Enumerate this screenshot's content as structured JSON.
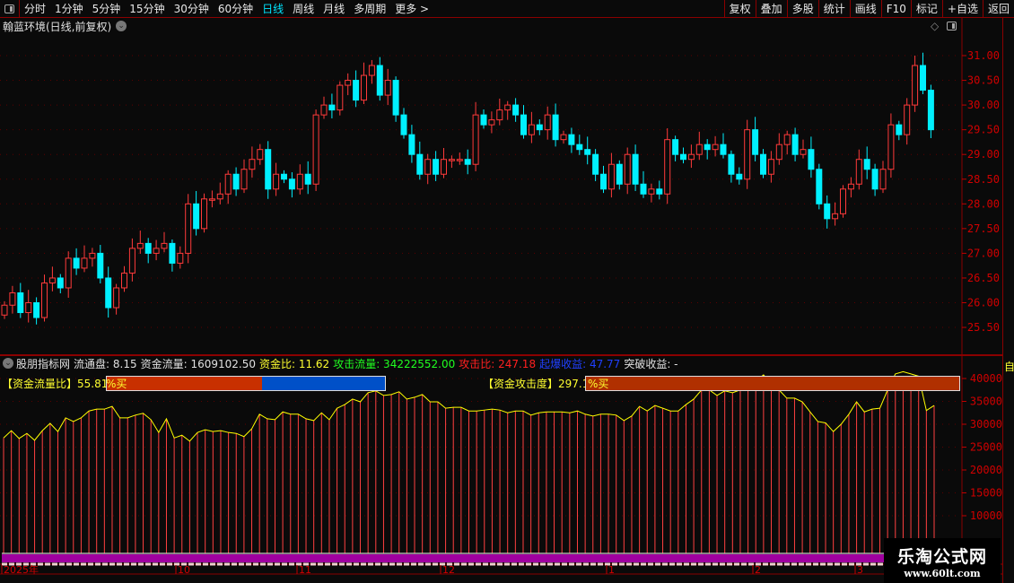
{
  "menu": {
    "periods": [
      "分时",
      "1分钟",
      "5分钟",
      "15分钟",
      "30分钟",
      "60分钟",
      "日线",
      "周线",
      "月线",
      "多周期",
      "更多 >"
    ],
    "active_period": "日线",
    "buttons": [
      "复权",
      "叠加",
      "多股",
      "统计",
      "画线",
      "F10",
      "标记",
      "+自选",
      "返回"
    ]
  },
  "title": "翰蓝环境(日线,前复权)",
  "colors": {
    "up": "#ff3a3a",
    "down": "#00f0ff",
    "axis": "#c00000",
    "line": "#ffff00",
    "purple": "#a000a0"
  },
  "price_axis": [
    "31.00",
    "30.50",
    "30.00",
    "29.50",
    "29.00",
    "28.50",
    "28.00",
    "27.50",
    "27.00",
    "26.50",
    "26.00",
    "25.50"
  ],
  "chart_data": [
    {
      "type": "candlestick",
      "title": "翰蓝环境(日线,前复权)",
      "ylim": [
        25.2,
        31.5
      ],
      "close": [
        25.95,
        26.2,
        25.8,
        26.0,
        25.7,
        26.4,
        26.5,
        26.3,
        26.9,
        26.7,
        26.9,
        27.0,
        26.5,
        25.9,
        26.3,
        26.6,
        27.1,
        27.2,
        27.0,
        27.1,
        27.2,
        26.8,
        27.0,
        28.0,
        27.5,
        28.1,
        28.1,
        28.2,
        28.6,
        28.3,
        28.7,
        28.9,
        29.1,
        28.3,
        28.6,
        28.5,
        28.3,
        28.6,
        28.4,
        29.8,
        30.0,
        29.9,
        30.4,
        30.5,
        30.1,
        30.6,
        30.8,
        30.2,
        30.5,
        29.8,
        29.4,
        29.0,
        28.6,
        28.9,
        28.6,
        28.9,
        28.9,
        28.9,
        28.8,
        29.8,
        29.6,
        29.7,
        29.9,
        30.0,
        29.8,
        29.4,
        29.6,
        29.5,
        29.8,
        29.3,
        29.4,
        29.2,
        29.1,
        29.0,
        28.6,
        28.3,
        28.8,
        28.4,
        29.0,
        28.4,
        28.2,
        28.3,
        28.2,
        29.3,
        29.0,
        28.9,
        29.0,
        29.2,
        29.1,
        29.2,
        29.0,
        28.6,
        28.5,
        29.5,
        29.0,
        28.6,
        28.9,
        29.2,
        29.4,
        29.0,
        29.1,
        28.7,
        28.0,
        27.7,
        27.8,
        28.3,
        28.4,
        28.9,
        28.7,
        28.3,
        28.7,
        29.6,
        29.4,
        30.0,
        30.8,
        30.3,
        29.5
      ],
      "first_open": 25.75
    },
    {
      "type": "bar",
      "title": "股朋指标网",
      "ylim": [
        0,
        42000
      ],
      "yticks": [
        "40000",
        "35000",
        "30000",
        "25000",
        "20000",
        "15000",
        "10000"
      ],
      "values": [
        27000,
        28600,
        26900,
        28000,
        26500,
        28600,
        30200,
        28400,
        31400,
        30600,
        31400,
        32900,
        33300,
        33300,
        33900,
        31400,
        31400,
        32000,
        32400,
        31000,
        28200,
        31200,
        27000,
        27600,
        26300,
        28200,
        28800,
        28400,
        28600,
        28200,
        28000,
        27300,
        29000,
        32200,
        31200,
        31000,
        32700,
        32200,
        32200,
        31200,
        30800,
        32500,
        31000,
        33500,
        34300,
        35500,
        34900,
        36900,
        37300,
        36300,
        36500,
        37100,
        35500,
        35900,
        36500,
        34900,
        34900,
        33500,
        33700,
        33700,
        32900,
        32900,
        33100,
        33300,
        33100,
        32500,
        32900,
        32900,
        32000,
        32500,
        32700,
        32700,
        32700,
        32500,
        32900,
        32200,
        31800,
        32200,
        32200,
        32000,
        30800,
        31800,
        33900,
        32900,
        34100,
        33500,
        32900,
        32900,
        34300,
        35500,
        37500,
        37500,
        36300,
        37300,
        36900,
        37500,
        38400,
        39400,
        40800,
        38800,
        37500,
        35700,
        35700,
        34900,
        32700,
        30600,
        30300,
        28400,
        30000,
        32200,
        34900,
        32700,
        33300,
        33500,
        37500,
        41000,
        41500,
        41000,
        40500,
        33000,
        34100
      ]
    }
  ],
  "indicator": {
    "name": "股朋指标网",
    "items": [
      {
        "label": "流通盘: 8.15",
        "color": "#e0e0e0"
      },
      {
        "label": "资金流量: 1609102.50",
        "color": "#e0e0e0"
      },
      {
        "label": "资金比: 11.62",
        "color": "#ffff30"
      },
      {
        "label": "攻击流量: 34222552.00",
        "color": "#20ff20"
      },
      {
        "label": "攻击比: 247.18",
        "color": "#ff2020"
      },
      {
        "label": "起爆收益: 47.77",
        "color": "#2040ff"
      },
      {
        "label": "突破收益: -",
        "color": "#e0e0e0"
      }
    ],
    "flow_ratio_label": "【资金流量比】55.81",
    "flow_ratio_unit": "%买",
    "flow_ratio_pct": 55.81,
    "attack_label": "【资金攻击度】297.18",
    "attack_unit": "%买"
  },
  "dates": [
    "2025年",
    "10",
    "11",
    "12",
    "1",
    "2",
    "3"
  ],
  "side_label": "自",
  "watermark": {
    "name": "乐淘公式网",
    "url": "www.60lt.com"
  }
}
